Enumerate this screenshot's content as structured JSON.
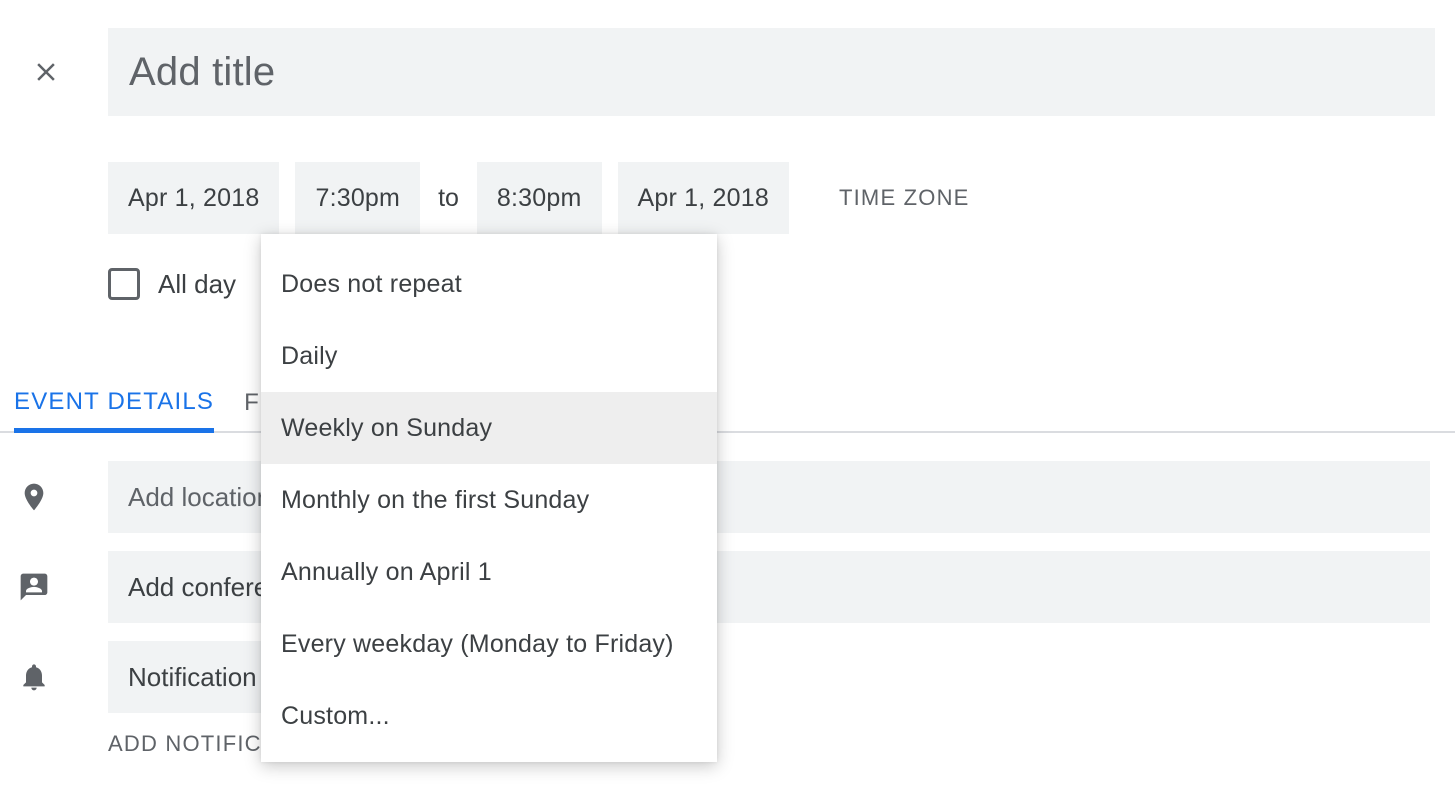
{
  "title": {
    "placeholder": "Add title",
    "value": ""
  },
  "dates": {
    "start_date": "Apr 1, 2018",
    "start_time": "7:30pm",
    "to_label": "to",
    "end_time": "8:30pm",
    "end_date": "Apr 1, 2018",
    "timezone_label": "TIME ZONE"
  },
  "allday": {
    "label": "All day",
    "checked": false
  },
  "tabs": {
    "event_details": "EVENT DETAILS",
    "find_time": "FIND A TIME"
  },
  "location": {
    "placeholder": "Add location",
    "value": ""
  },
  "conferencing": {
    "label": "Add conferencing"
  },
  "notification": {
    "label": "Notification",
    "add_label": "ADD NOTIFICATION"
  },
  "repeat_menu": {
    "options": [
      "Does not repeat",
      "Daily",
      "Weekly on Sunday",
      "Monthly on the first Sunday",
      "Annually on April 1",
      "Every weekday (Monday to Friday)",
      "Custom..."
    ],
    "hovered_index": 2
  }
}
